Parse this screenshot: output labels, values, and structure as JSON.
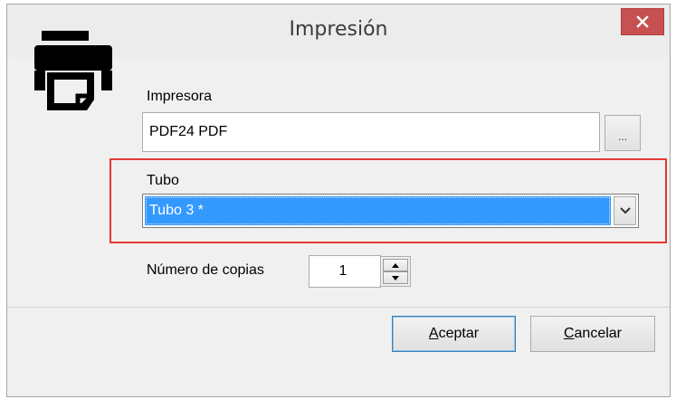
{
  "window": {
    "title": "Impresión",
    "close_icon": "close-icon"
  },
  "printer": {
    "icon": "printer-icon",
    "label": "Impresora",
    "value": "PDF24 PDF",
    "browse_label": "..."
  },
  "tube": {
    "label": "Tubo",
    "selected": "Tubo 3  *",
    "arrow_icon": "chevron-down-icon"
  },
  "copies": {
    "label": "Número de copias",
    "value": "1"
  },
  "buttons": {
    "accept_accel": "A",
    "accept_rest": "ceptar",
    "cancel_accel": "C",
    "cancel_rest": "ancelar"
  },
  "colors": {
    "highlight_border": "#e53935",
    "selection": "#3399ff",
    "close_button": "#c75050"
  }
}
